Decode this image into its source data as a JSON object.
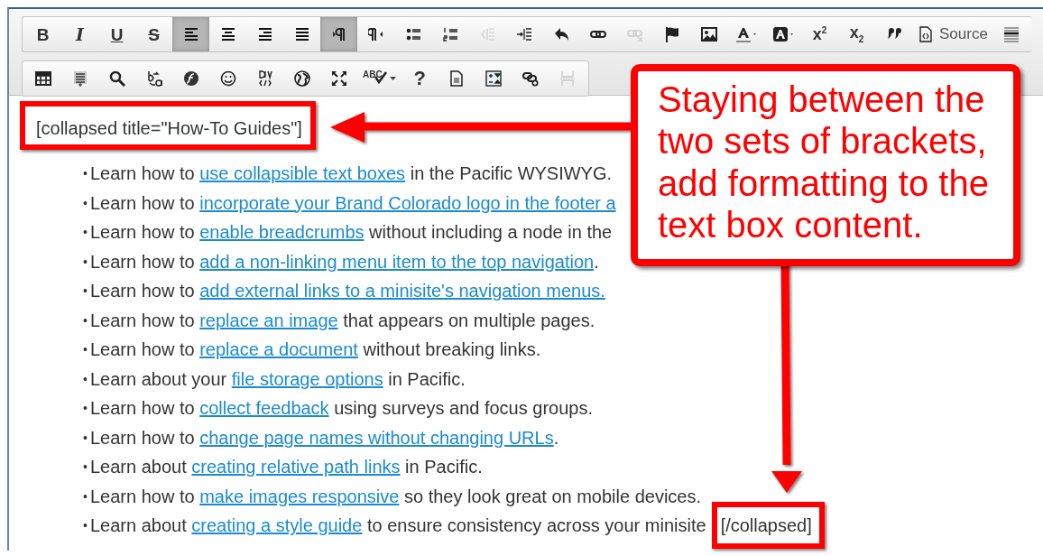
{
  "toolbar": {
    "rows": [
      {
        "buttons": [
          {
            "kind": "bold",
            "glyph": "B",
            "selected": false,
            "disabled": false
          },
          {
            "kind": "italic",
            "glyph": "I",
            "selected": false,
            "disabled": false
          },
          {
            "kind": "underline",
            "glyph": "U",
            "selected": false,
            "disabled": false
          },
          {
            "kind": "strike",
            "glyph": "S",
            "selected": false,
            "disabled": false
          },
          {
            "kind": "align-left",
            "selected": true,
            "disabled": false
          },
          {
            "kind": "align-center",
            "selected": false,
            "disabled": false
          },
          {
            "kind": "align-right",
            "selected": false,
            "disabled": false
          },
          {
            "kind": "justify",
            "selected": false,
            "disabled": false
          },
          {
            "kind": "ltr",
            "selected": true,
            "disabled": false
          },
          {
            "kind": "rtl",
            "selected": false,
            "disabled": false
          },
          {
            "kind": "bulleted-list",
            "selected": false,
            "disabled": false
          },
          {
            "kind": "numbered-list",
            "selected": false,
            "disabled": false
          },
          {
            "kind": "outdent",
            "selected": false,
            "disabled": true
          },
          {
            "kind": "indent",
            "selected": false,
            "disabled": false
          },
          {
            "kind": "undo",
            "selected": false,
            "disabled": false
          },
          {
            "kind": "link",
            "selected": false,
            "disabled": false
          },
          {
            "kind": "unlink",
            "selected": false,
            "disabled": true
          },
          {
            "kind": "anchor",
            "selected": false,
            "disabled": false
          },
          {
            "kind": "image",
            "selected": false,
            "disabled": false
          },
          {
            "kind": "text-color",
            "selected": false,
            "disabled": false
          },
          {
            "kind": "background-color",
            "selected": false,
            "disabled": false
          },
          {
            "kind": "superscript",
            "glyph": "x$^{2}$",
            "selected": false,
            "disabled": false
          },
          {
            "kind": "subscript",
            "glyph": "x$_{2}$",
            "selected": false,
            "disabled": false
          },
          {
            "kind": "blockquote",
            "selected": false,
            "disabled": false
          },
          {
            "kind": "source",
            "label": "Source",
            "selected": false,
            "disabled": false
          },
          {
            "kind": "more",
            "selected": false,
            "disabled": false
          }
        ]
      },
      {
        "buttons": [
          {
            "kind": "table",
            "selected": false,
            "disabled": false
          },
          {
            "kind": "template",
            "selected": false,
            "disabled": false
          },
          {
            "kind": "find",
            "selected": false,
            "disabled": false
          },
          {
            "kind": "replace",
            "selected": false,
            "disabled": false
          },
          {
            "kind": "flash",
            "selected": false,
            "disabled": false
          },
          {
            "kind": "smiley",
            "selected": false,
            "disabled": false
          },
          {
            "kind": "div",
            "selected": false,
            "disabled": false
          },
          {
            "kind": "globe",
            "selected": false,
            "disabled": false
          },
          {
            "kind": "maximize",
            "selected": false,
            "disabled": false
          },
          {
            "kind": "spellcheck",
            "glyph": "ABC",
            "selected": false,
            "disabled": false
          },
          {
            "kind": "help",
            "glyph": "?",
            "selected": false,
            "disabled": false
          },
          {
            "kind": "document",
            "selected": false,
            "disabled": false
          },
          {
            "kind": "sort",
            "selected": false,
            "disabled": false
          },
          {
            "kind": "link-add",
            "selected": false,
            "disabled": false
          },
          {
            "kind": "page-break",
            "selected": false,
            "disabled": true
          }
        ]
      }
    ]
  },
  "content": {
    "bullet": "•",
    "open_tag": "[collapsed title=\"How-To Guides\"]",
    "items": [
      {
        "prefix": "Learn how to ",
        "link": "use collapsible text boxes",
        "suffix": " in the Pacific WYSIWYG."
      },
      {
        "prefix": "Learn how to ",
        "link": "incorporate your Brand Colorado logo in the footer a"
      },
      {
        "prefix": "Learn how to ",
        "link": "enable breadcrumbs",
        "suffix": " without including a node in the"
      },
      {
        "prefix": "Learn how to ",
        "link": "add a non-linking menu item to the top navigation",
        "suffix": "."
      },
      {
        "prefix": "Learn how to ",
        "link": "add external links to a minisite's navigation menus."
      },
      {
        "prefix": "Learn how to ",
        "link": "replace an image",
        "suffix": " that appears on multiple pages."
      },
      {
        "prefix": "Learn how to ",
        "link": "replace a document",
        "suffix": " without breaking links."
      },
      {
        "prefix": "Learn about your ",
        "link": "file storage options",
        "suffix": " in Pacific."
      },
      {
        "prefix": "Learn how to ",
        "link": "collect feedback",
        "suffix": " using surveys and focus groups."
      },
      {
        "prefix": "Learn how to ",
        "link": "change page names without changing URLs",
        "suffix": "."
      },
      {
        "prefix": "Learn about ",
        "link": "creating relative path links",
        "suffix": " in Pacific."
      },
      {
        "prefix": "Learn how to ",
        "link": "make images responsive",
        "suffix": " so they look great on mobile devices."
      },
      {
        "prefix": "Learn about ",
        "link": "creating a style guide",
        "suffix": " to ensure consistency across your minisite"
      }
    ],
    "close_tag": "[/collapsed]"
  },
  "callout": {
    "text": "Staying between the two sets of brackets, add formatting to the text box content."
  }
}
